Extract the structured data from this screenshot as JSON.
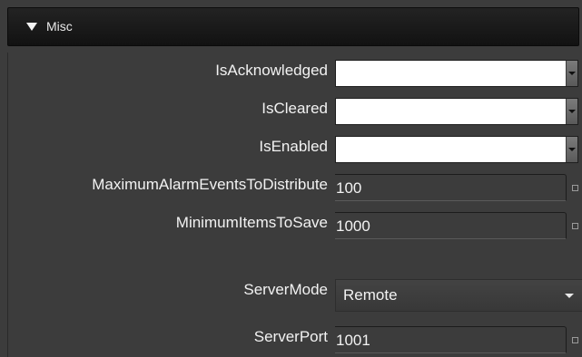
{
  "section": {
    "title": "Misc",
    "expanded_icon": "triangle-down-icon"
  },
  "properties": [
    {
      "label": "IsAcknowledged",
      "kind": "combo",
      "value": ""
    },
    {
      "label": "IsCleared",
      "kind": "combo",
      "value": ""
    },
    {
      "label": "IsEnabled",
      "kind": "combo",
      "value": ""
    },
    {
      "label": "MaximumAlarmEventsToDistribute",
      "kind": "text",
      "value": "100"
    },
    {
      "label": "MinimumItemsToSave",
      "kind": "text",
      "value": "1000"
    },
    {
      "label": "ServerMode",
      "kind": "select",
      "value": "Remote"
    },
    {
      "label": "ServerPort",
      "kind": "text",
      "value": "1001"
    }
  ]
}
